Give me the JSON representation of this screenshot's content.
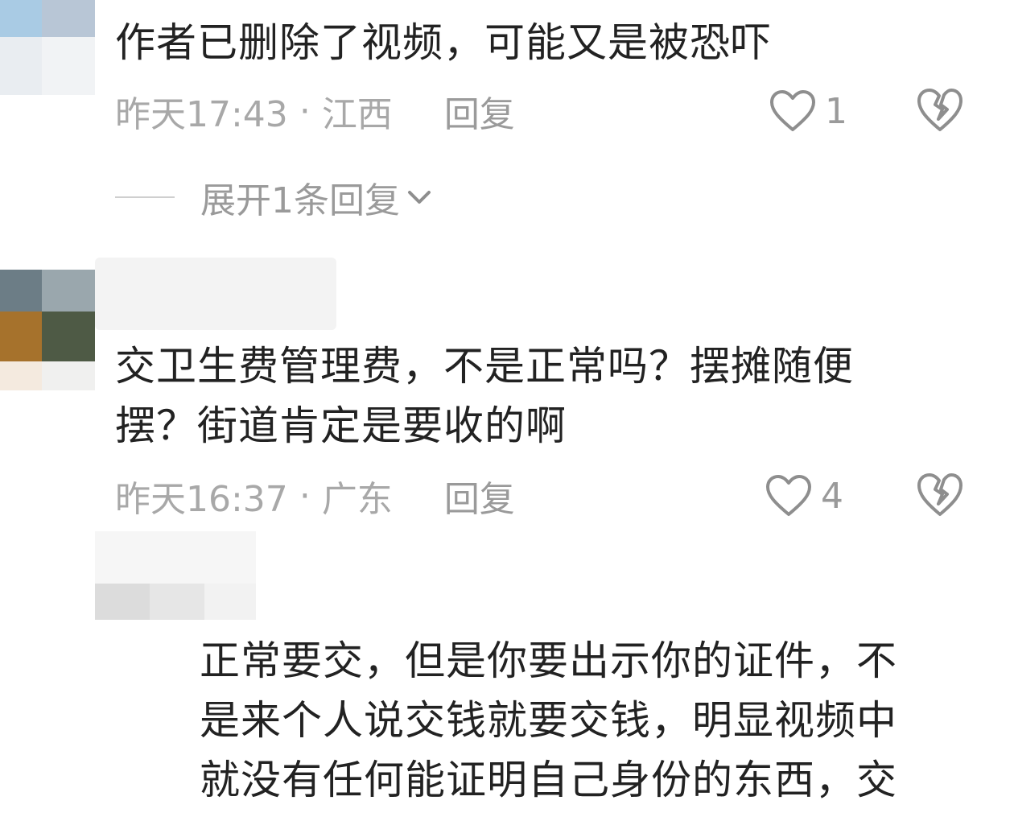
{
  "comments": [
    {
      "text_lines": [
        "作者已删除了视频，可能又是被恐吓"
      ],
      "time": "昨天17:43",
      "location": "江西",
      "reply_label": "回复",
      "likes": "1",
      "expand_label": "展开1条回复"
    },
    {
      "text_lines": [
        "交卫生费管理费，不是正常吗？摆摊随便",
        "摆？街道肯定是要收的啊"
      ],
      "time": "昨天16:37",
      "location": "广东",
      "reply_label": "回复",
      "likes": "4"
    },
    {
      "text_lines": [
        "正常要交，但是你要出示你的证件，不",
        "是来个人说交钱就要交钱，明显视频中",
        "就没有任何能证明自己身份的东西，交"
      ]
    }
  ],
  "meta_separator": "·",
  "icons": {
    "like": "heart-outline-icon",
    "dislike": "broken-heart-icon",
    "expand": "chevron-down-icon"
  },
  "colors": {
    "text": "#222222",
    "meta": "#a8a8a8",
    "icon": "#8e8e8e"
  }
}
